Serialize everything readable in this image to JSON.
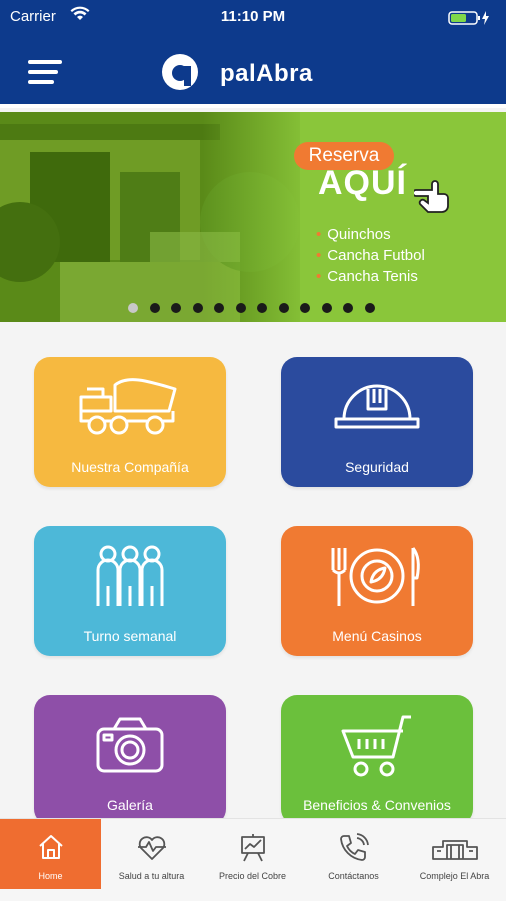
{
  "status": {
    "carrier": "Carrier",
    "time": "11:10 PM"
  },
  "header": {
    "title": "palAbra",
    "menu_icon": "hamburger-menu-icon",
    "logo_icon": "palabra-logo-icon"
  },
  "banner": {
    "badge": "Reserva",
    "headline": "AQUÍ",
    "items": [
      "Quinchos",
      "Cancha Futbol",
      "Cancha Tenis"
    ],
    "dot_count": 12,
    "active_dot": 0
  },
  "tiles": [
    {
      "label": "Nuestra Compañía",
      "color": "#f6b940",
      "icon": "dump-truck-icon"
    },
    {
      "label": "Seguridad",
      "color": "#2b4b9e",
      "icon": "hard-hat-icon"
    },
    {
      "label": "Turno semanal",
      "color": "#4db8d8",
      "icon": "people-group-icon"
    },
    {
      "label": "Menú Casinos",
      "color": "#f07a32",
      "icon": "plate-cutlery-icon"
    },
    {
      "label": "Galería",
      "color": "#8e4fa8",
      "icon": "camera-icon"
    },
    {
      "label": "Beneficios & Convenios",
      "color": "#6bc03c",
      "icon": "shopping-cart-icon"
    }
  ],
  "tabs": [
    {
      "label": "Home",
      "icon": "home-icon",
      "active": true
    },
    {
      "label": "Salud a tu altura",
      "icon": "heart-pulse-icon",
      "active": false
    },
    {
      "label": "Precio del Cobre",
      "icon": "chart-board-icon",
      "active": false
    },
    {
      "label": "Contáctanos",
      "icon": "phone-icon",
      "active": false
    },
    {
      "label": "Complejo El Abra",
      "icon": "building-icon",
      "active": false
    }
  ],
  "colors": {
    "primary": "#0d3a8c",
    "accent": "#ef6d30",
    "banner_green": "#8cc83a"
  }
}
